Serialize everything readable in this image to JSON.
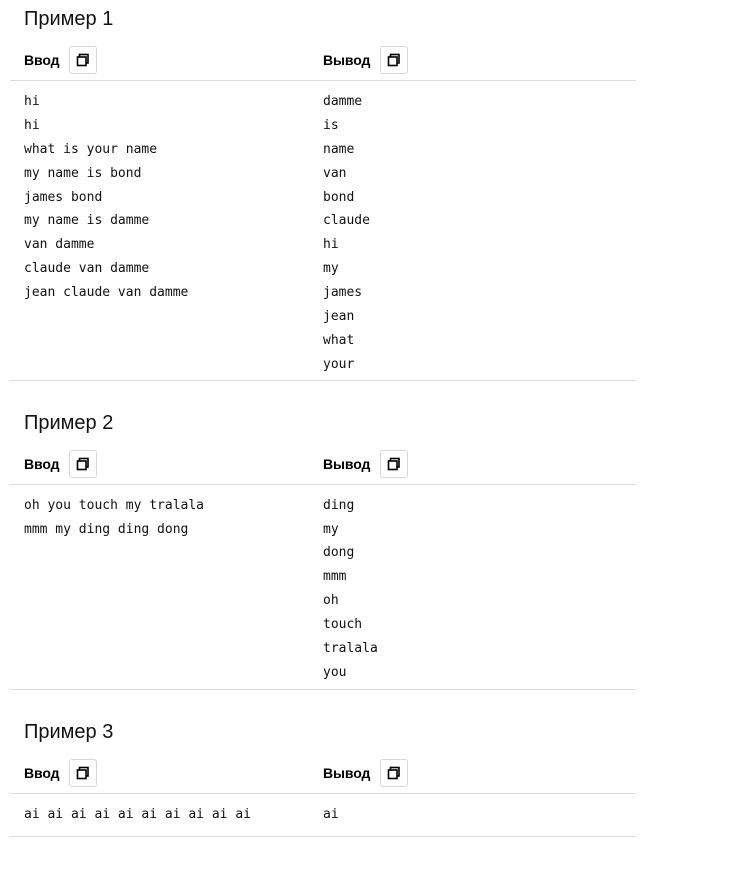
{
  "examples": [
    {
      "title": "Пример 1",
      "input_label": "Ввод",
      "output_label": "Вывод",
      "input_lines": [
        "hi",
        "hi",
        "what is your name",
        "my name is bond",
        "james bond",
        "my name is damme",
        "van damme",
        "claude van damme",
        "jean claude van damme"
      ],
      "output_lines": [
        "damme",
        "is",
        "name",
        "van",
        "bond",
        "claude",
        "hi",
        "my",
        "james",
        "jean",
        "what",
        "your"
      ]
    },
    {
      "title": "Пример 2",
      "input_label": "Ввод",
      "output_label": "Вывод",
      "input_lines": [
        "oh you touch my tralala",
        "mmm my ding ding dong"
      ],
      "output_lines": [
        "ding",
        "my",
        "dong",
        "mmm",
        "oh",
        "touch",
        "tralala",
        "you"
      ]
    },
    {
      "title": "Пример 3",
      "input_label": "Ввод",
      "output_label": "Вывод",
      "input_lines": [
        "ai ai ai ai ai ai ai ai ai ai"
      ],
      "output_lines": [
        "ai"
      ]
    }
  ]
}
